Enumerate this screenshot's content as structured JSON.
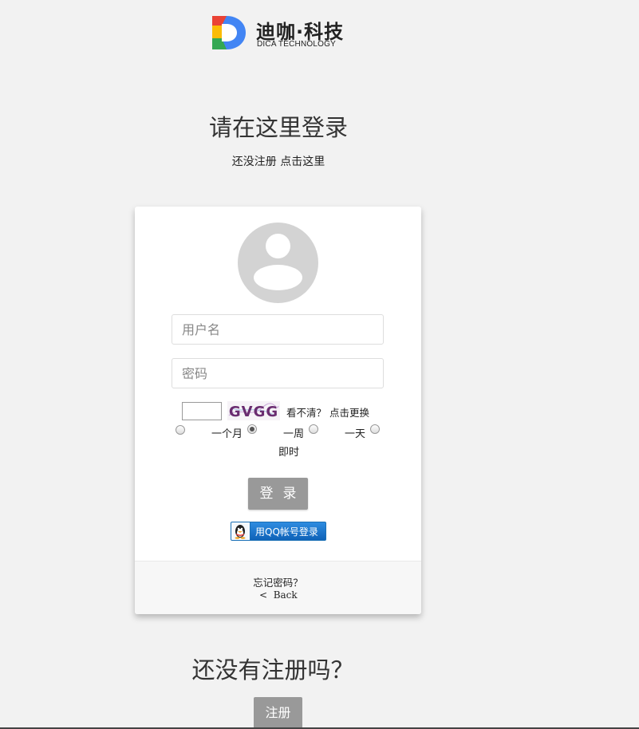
{
  "logo": {
    "name": "迪咖·科技",
    "subtitle": "DICA TECHNOLOGY",
    "colors": [
      "#ea4335",
      "#fbbc05",
      "#34a853",
      "#4285f4"
    ]
  },
  "header": {
    "title": "请在这里登录",
    "not_registered": "还没注册",
    "click_here": "点击这里"
  },
  "form": {
    "username_placeholder": "用户名",
    "password_placeholder": "密码",
    "captcha_code": "GVGG",
    "captcha_hint": "看不清？",
    "captcha_refresh": "点击更换",
    "remember_options": [
      {
        "label": "一个月",
        "checked": false
      },
      {
        "label": "一周",
        "checked": true
      },
      {
        "label": "一天",
        "checked": false
      },
      {
        "label": "即时",
        "checked": false
      }
    ],
    "login_label": "登录",
    "qq_login_label": "用QQ帐号登录"
  },
  "footer": {
    "forgot_password": "忘记密码？",
    "back_label": "Back"
  },
  "bottom": {
    "title": "还没有注册吗？",
    "register_label": "注册"
  },
  "colors": {
    "background": "#f2f2f2",
    "button_gray": "#999999",
    "qq_blue": "#0f62b8"
  }
}
